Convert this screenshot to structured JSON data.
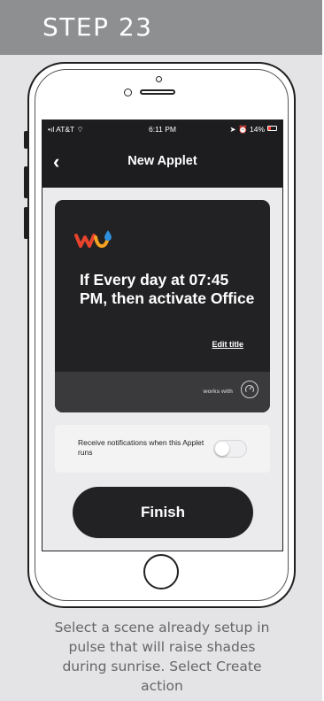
{
  "step": {
    "title": "STEP 23"
  },
  "status_bar": {
    "carrier": "AT&T",
    "time": "6:11 PM",
    "battery": "14%"
  },
  "nav": {
    "title": "New Applet",
    "back_icon": "chevron-left-icon"
  },
  "applet_card": {
    "service_logo": "weather-underground-logo",
    "title": "If Every day at 07:45 PM, then activate Office",
    "edit_title_label": "Edit title",
    "works_with_label": "works with"
  },
  "notifications": {
    "label": "Receive notifications when this Applet runs",
    "enabled": false
  },
  "finish_button": {
    "label": "Finish"
  },
  "caption": "Select a scene already setup in pulse that will raise shades during sunrise. Select Create action",
  "colors": {
    "header_bg": "#8e8f91",
    "panel_bg": "#e4e4e6",
    "card_bg": "#222224",
    "button_bg": "#222224"
  }
}
